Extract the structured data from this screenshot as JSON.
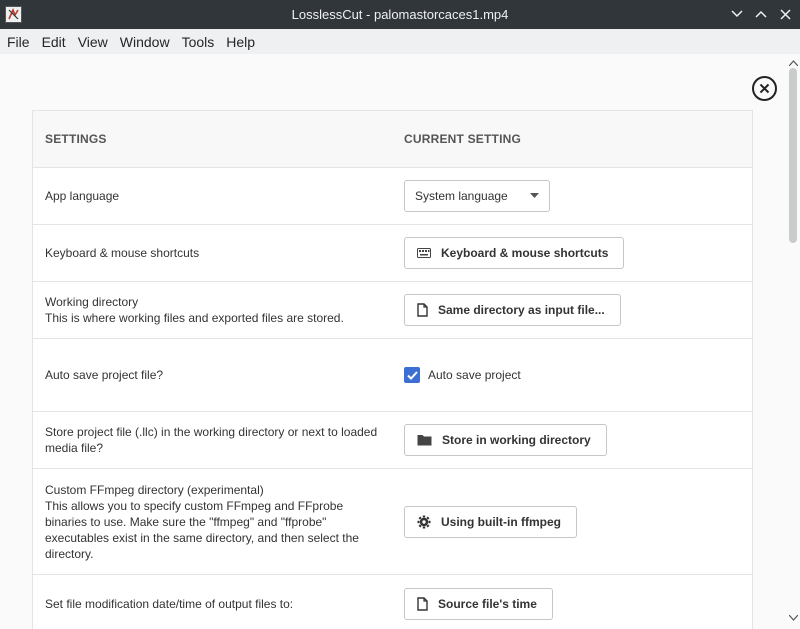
{
  "window": {
    "title": "LosslessCut - palomastorcaces1.mp4"
  },
  "menu": [
    "File",
    "Edit",
    "View",
    "Window",
    "Tools",
    "Help"
  ],
  "settings": {
    "header_setting": "SETTINGS",
    "header_current": "CURRENT SETTING",
    "rows": [
      {
        "label": "App language",
        "control": "select",
        "value": "System language"
      },
      {
        "label": "Keyboard & mouse shortcuts",
        "control": "button",
        "icon": "keyboard-icon",
        "value": "Keyboard & mouse shortcuts"
      },
      {
        "label": "Working directory",
        "desc": "This is where working files and exported files are stored.",
        "control": "button",
        "icon": "file-icon",
        "value": "Same directory as input file..."
      },
      {
        "label": "Auto save project file?",
        "control": "checkbox",
        "checked": true,
        "value": "Auto save project"
      },
      {
        "label": "Store project file (.llc) in the working directory or next to loaded media file?",
        "control": "button",
        "icon": "folder-icon",
        "value": "Store in working directory"
      },
      {
        "label": "Custom FFmpeg directory (experimental)",
        "desc": "This allows you to specify custom FFmpeg and FFprobe binaries to use. Make sure the \"ffmpeg\" and \"ffprobe\" executables exist in the same directory, and then select the directory.",
        "control": "button",
        "icon": "gear-icon",
        "value": "Using built-in ffmpeg"
      },
      {
        "label": "Set file modification date/time of output files to:",
        "control": "button",
        "icon": "file-icon",
        "value": "Source file's time"
      }
    ]
  }
}
